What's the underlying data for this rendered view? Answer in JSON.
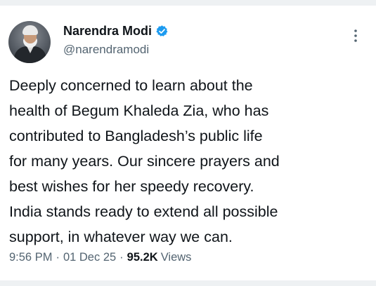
{
  "author": {
    "display_name": "Narendra Modi",
    "handle": "@narendramodi",
    "verified": true
  },
  "tweet": {
    "lines": [
      "Deeply concerned to learn about the",
      "health of Begum Khaleda Zia, who has",
      "contributed to Bangladesh’s public life",
      "for many years. Our sincere prayers and",
      "best wishes for her speedy recovery.",
      "India stands ready to extend all possible",
      "support, in whatever way we can."
    ]
  },
  "meta": {
    "time": "9:56 PM",
    "separator": "·",
    "date": "01 Dec 25",
    "views_count": "95.2K",
    "views_label": "Views"
  },
  "icons": {
    "verified": "verified-badge-icon",
    "more": "more-options-icon"
  },
  "colors": {
    "verified_blue": "#1d9bf0",
    "text_primary": "#0f1419",
    "text_secondary": "#536471"
  }
}
